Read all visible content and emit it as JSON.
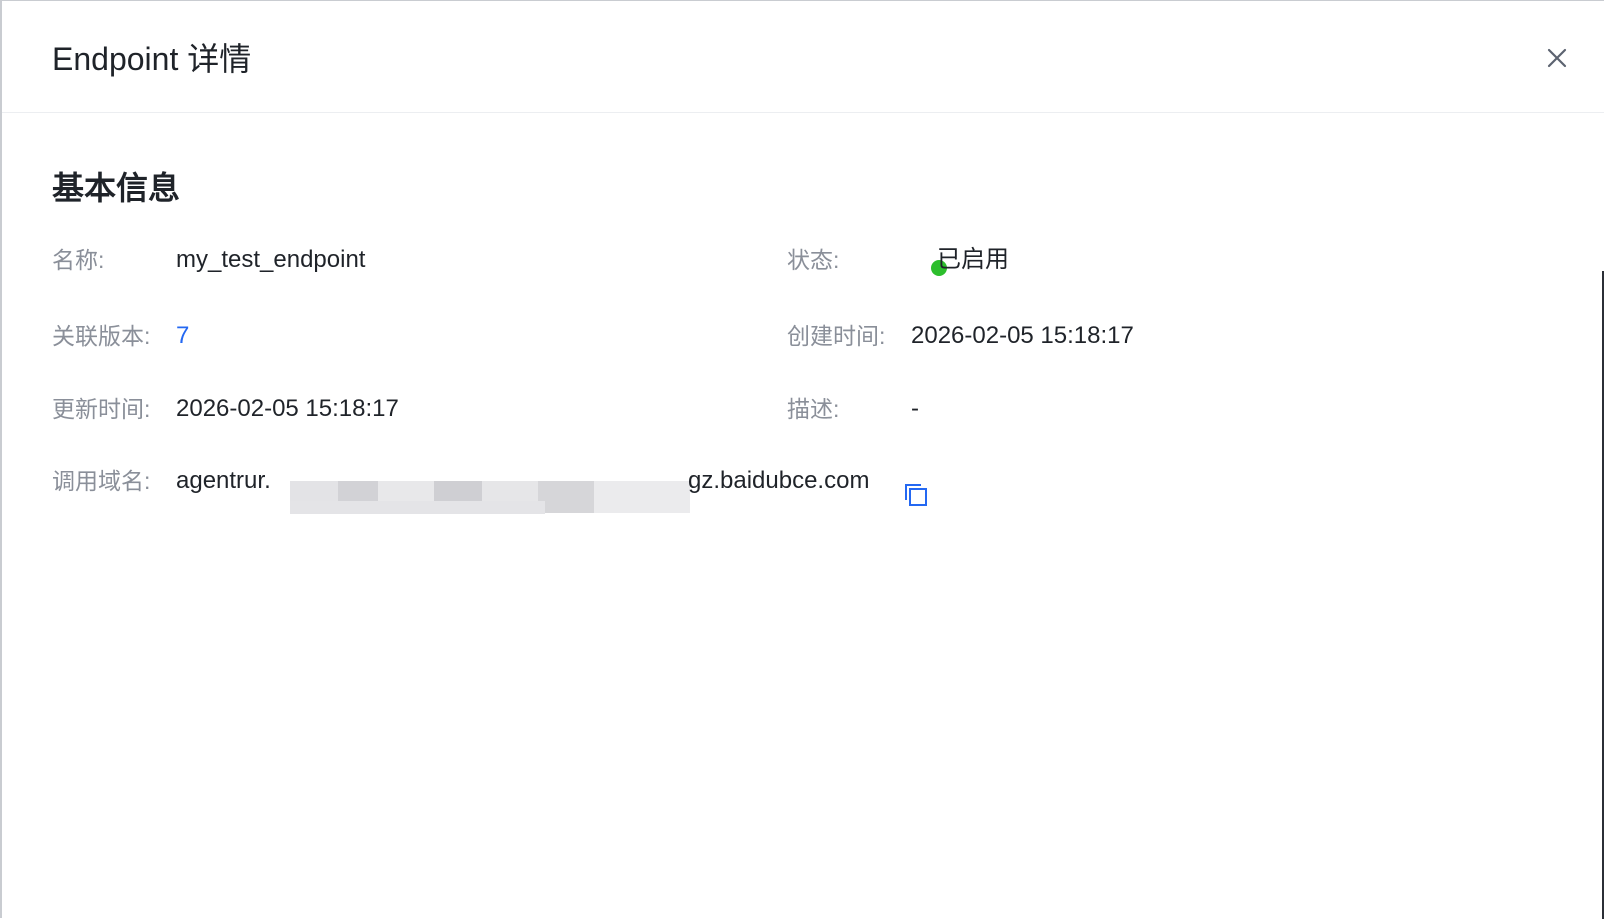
{
  "header": {
    "title": "Endpoint 详情",
    "close_icon": "close-icon"
  },
  "section": {
    "title": "基本信息"
  },
  "fields": {
    "name": {
      "label": "名称:",
      "value": "my_test_endpoint"
    },
    "status": {
      "label": "状态:",
      "value": "已启用",
      "dot_color": "#2dbe2d"
    },
    "version": {
      "label": "关联版本:",
      "value": "7",
      "link_color": "#2468f2"
    },
    "created": {
      "label": "创建时间:",
      "value": "2026-02-05 15:18:17"
    },
    "updated": {
      "label": "更新时间:",
      "value": "2026-02-05 15:18:17"
    },
    "description": {
      "label": "描述:",
      "value": "-"
    },
    "domain": {
      "label": "调用域名:",
      "value_prefix": "agentrur.",
      "value_suffix": "gz.baidubce.com",
      "copy_icon": "copy-icon"
    }
  }
}
